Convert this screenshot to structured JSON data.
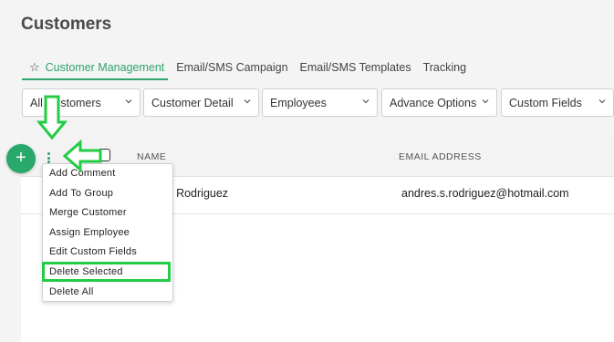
{
  "page": {
    "title": "Customers"
  },
  "tabs": [
    {
      "label": "Customer Management",
      "active": true
    },
    {
      "label": "Email/SMS Campaign",
      "active": false
    },
    {
      "label": "Email/SMS Templates",
      "active": false
    },
    {
      "label": "Tracking",
      "active": false
    }
  ],
  "filters": [
    {
      "value": "All Customers"
    },
    {
      "value": "Customer Detail"
    },
    {
      "value": "Employees"
    },
    {
      "value": "Advance Options"
    },
    {
      "value": "Custom Fields"
    }
  ],
  "table": {
    "columns": [
      "NAME",
      "EMAIL ADDRESS"
    ],
    "rows": [
      {
        "name": "Andres Rodriguez",
        "email": "andres.s.rodriguez@hotmail.com"
      }
    ]
  },
  "fab": {
    "label": "+"
  },
  "menu": {
    "items": [
      "Add Comment",
      "Add To Group",
      "Merge Customer",
      "Assign Employee",
      "Edit Custom Fields",
      "Delete Selected",
      "Delete All"
    ],
    "highlighted": "Delete Selected"
  },
  "colors": {
    "accent": "#2fa36b",
    "fab": "#28a86b",
    "annotation": "#22cc44"
  },
  "icons": {
    "star": "☆",
    "chevron": "chevron-down-icon",
    "kebab": "kebab-icon"
  }
}
